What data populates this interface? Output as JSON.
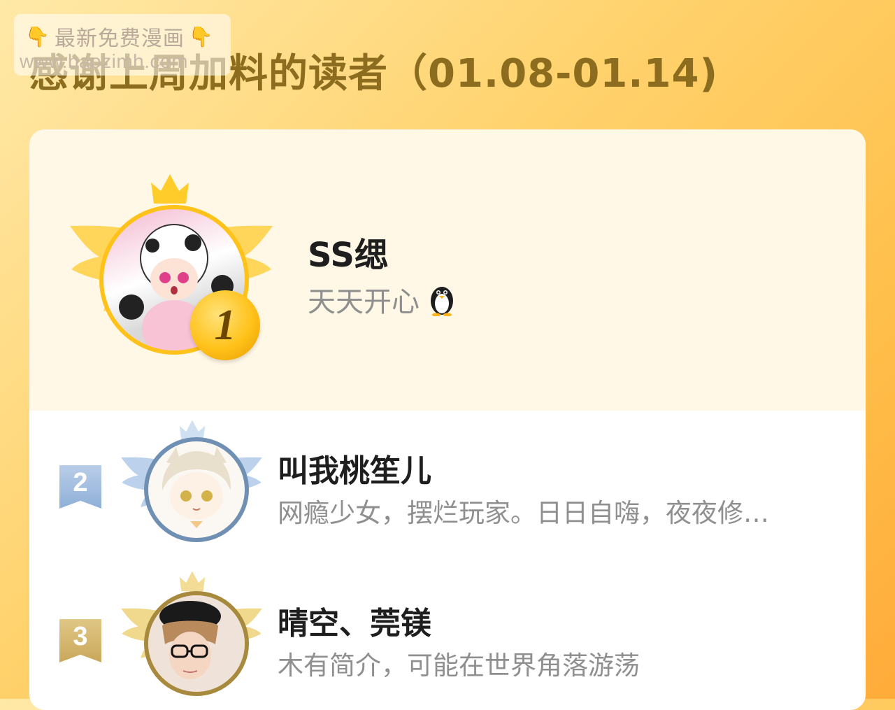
{
  "watermark": {
    "line1": "最新免费漫画",
    "hand_icon": "pointing-down-hand",
    "line2": "www.baozimh.com"
  },
  "title": "感谢上周加料的读者（01.08-01.14)",
  "entries": [
    {
      "rank": "1",
      "name": "SS缌",
      "bio": "天天开心",
      "bio_icon": "penguin-icon",
      "accent": "#ffc21a"
    },
    {
      "rank": "2",
      "name": "叫我桃笙儿",
      "bio": "网瘾少女，摆烂玩家。日日自嗨，夜夜修…",
      "accent": "#8fb0d8"
    },
    {
      "rank": "3",
      "name": "晴空、莞镁",
      "bio": "木有简介，可能在世界角落游荡",
      "accent": "#c9a75a"
    }
  ]
}
